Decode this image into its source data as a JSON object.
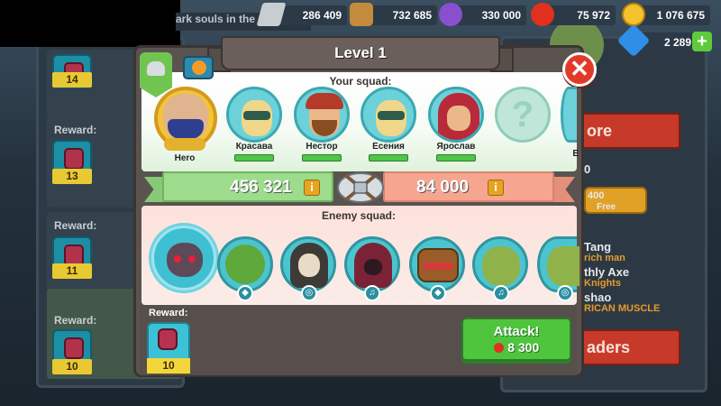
{
  "background": {
    "ticker_text": "ark souls in the pa",
    "left_rewards": [
      {
        "label": "",
        "count": "14"
      },
      {
        "label": "Reward:",
        "count": "13"
      },
      {
        "label": "Reward:",
        "count": "11"
      },
      {
        "label": "Reward:",
        "count": "10"
      }
    ],
    "right_panel": {
      "store_label": "ore",
      "zero_count": "0",
      "gold_amount": "400",
      "free_label": "Free",
      "list_lines": [
        {
          "text": "Tang",
          "color": "white"
        },
        {
          "text": "rich man",
          "color": "orange"
        },
        {
          "text": "thly Axe",
          "color": "white"
        },
        {
          "text": "Knights",
          "color": "orange"
        },
        {
          "text": "shao",
          "color": "white"
        },
        {
          "text": "RICAN MUSCLE",
          "color": "orange"
        }
      ],
      "leaders_label": "aders"
    }
  },
  "resources": [
    {
      "icon": "iron-icon",
      "value": "286 409"
    },
    {
      "icon": "wood-icon",
      "value": "732 685"
    },
    {
      "icon": "potion-icon",
      "value": "330 000"
    },
    {
      "icon": "apple-icon",
      "value": "75 972"
    },
    {
      "icon": "gold-coin-icon",
      "value": "1 076 675"
    },
    {
      "icon": "gem-icon",
      "value": "2 289"
    }
  ],
  "dialog": {
    "title": "Level 1",
    "your_squad_label": "Your squad:",
    "enemy_squad_label": "Enemy squad:",
    "hero": {
      "name": "Hero"
    },
    "squad": [
      {
        "name": "Красава"
      },
      {
        "name": "Нестор"
      },
      {
        "name": "Есения"
      },
      {
        "name": "Ярослав"
      },
      {
        "name": ""
      },
      {
        "name": "E"
      }
    ],
    "your_power": "456 321",
    "enemy_power": "84 000",
    "info_symbol": "i",
    "close_symbol": "✕",
    "reward_label": "Reward:",
    "reward_count": "10",
    "attack_label": "Attack!",
    "attack_cost": "8 300"
  },
  "colors": {
    "ally_green": "#9ddc8c",
    "enemy_red": "#f6a590",
    "attack_green": "#4fc53d",
    "close_red": "#e23a2a"
  }
}
